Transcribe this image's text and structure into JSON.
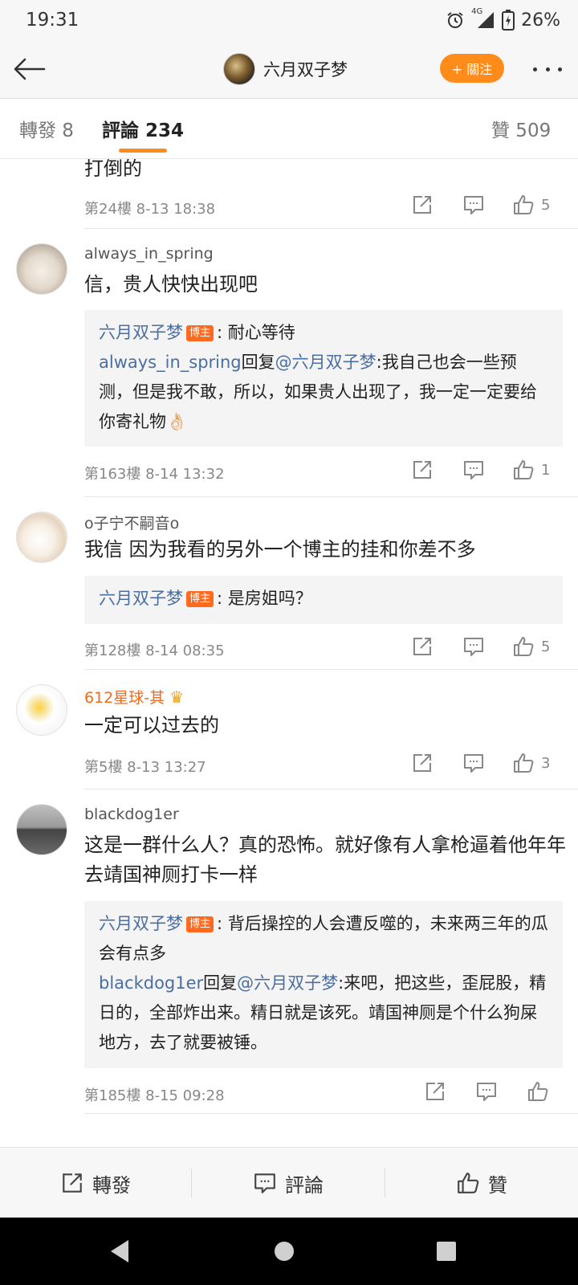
{
  "status": {
    "time": "19:31",
    "network": "4G",
    "battery": "26%"
  },
  "header": {
    "title": "六月双子梦",
    "follow_label": "+ 關注"
  },
  "tabs": {
    "repost": "轉發 8",
    "comment": "評論 234",
    "like": "贊 509"
  },
  "comments": [
    {
      "text": "打倒的",
      "meta": "第24樓 8-13 18:38",
      "likes": "5"
    },
    {
      "username": "always_in_spring",
      "text": "信，贵人快快出现吧",
      "reply1": {
        "name": "六月双子梦",
        "badge": "博主",
        "text": ": 耐心等待"
      },
      "reply2": {
        "name": "always_in_spring",
        "mid": "回复",
        "at": "@六月双子梦",
        "text": ":我自己也会一些预测，但是我不敢，所以，如果贵人出现了，我一定一定要给你寄礼物👌🏻"
      },
      "meta": "第163樓 8-14 13:32",
      "likes": "1"
    },
    {
      "username": "o子宁不嗣音o",
      "text": "我信  因为我看的另外一个博主的挂和你差不多",
      "reply1": {
        "name": "六月双子梦",
        "badge": "博主",
        "text": ": 是房姐吗？"
      },
      "meta": "第128樓 8-14 08:35",
      "likes": "5"
    },
    {
      "username": "612星球-其",
      "text": "一定可以过去的",
      "meta": "第5樓 8-13 13:27",
      "likes": "3"
    },
    {
      "username": "blackdog1er",
      "text": "这是一群什么人？真的恐怖。就好像有人拿枪逼着他年年去靖国神厕打卡一样",
      "reply1": {
        "name": "六月双子梦",
        "badge": "博主",
        "text": ": 背后操控的人会遭反噬的，未来两三年的瓜会有点多"
      },
      "reply2": {
        "name": "blackdog1er",
        "mid": "回复",
        "at": "@六月双子梦",
        "text": ":来吧，把这些，歪屁股，精日的，全部炸出来。精日就是该死。靖国神厕是个什么狗屎地方，去了就要被锤。"
      },
      "meta": "第185樓 8-15 09:28"
    }
  ],
  "bottom": {
    "repost": "轉發",
    "comment": "評論",
    "like": "贊"
  },
  "colors": {
    "accent": "#ff8c1a",
    "link": "#4a6ea2",
    "badge": "#ff6a1f"
  }
}
